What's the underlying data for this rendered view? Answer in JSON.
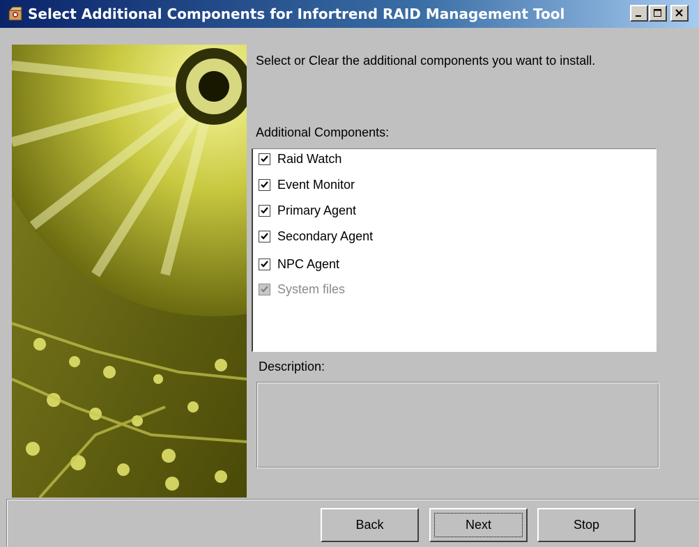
{
  "window": {
    "title": "Select Additional Components for Infortrend RAID Management Tool",
    "icon": "installer-package-icon",
    "buttons": [
      "minimize-icon",
      "maximize-icon",
      "close-icon"
    ]
  },
  "main": {
    "instruction": "Select or Clear the additional components you want to install.",
    "components_label": "Additional Components:",
    "components": [
      {
        "label": "Raid Watch",
        "checked": true,
        "enabled": true
      },
      {
        "label": "Event Monitor",
        "checked": true,
        "enabled": true
      },
      {
        "label": "Primary Agent",
        "checked": true,
        "enabled": true
      },
      {
        "label": "Secondary Agent",
        "checked": true,
        "enabled": true
      },
      {
        "label": "NPC Agent",
        "checked": true,
        "enabled": true
      },
      {
        "label": "System files",
        "checked": true,
        "enabled": false
      }
    ],
    "description_label": "Description:",
    "description_text": ""
  },
  "footer": {
    "back_label": "Back",
    "next_label": "Next",
    "stop_label": "Stop"
  },
  "colors": {
    "title_bar_start": "#0a246a",
    "title_bar_end": "#a6caf0",
    "dialog_bg": "#c0c0c0",
    "art_tone": "#b8b830"
  }
}
